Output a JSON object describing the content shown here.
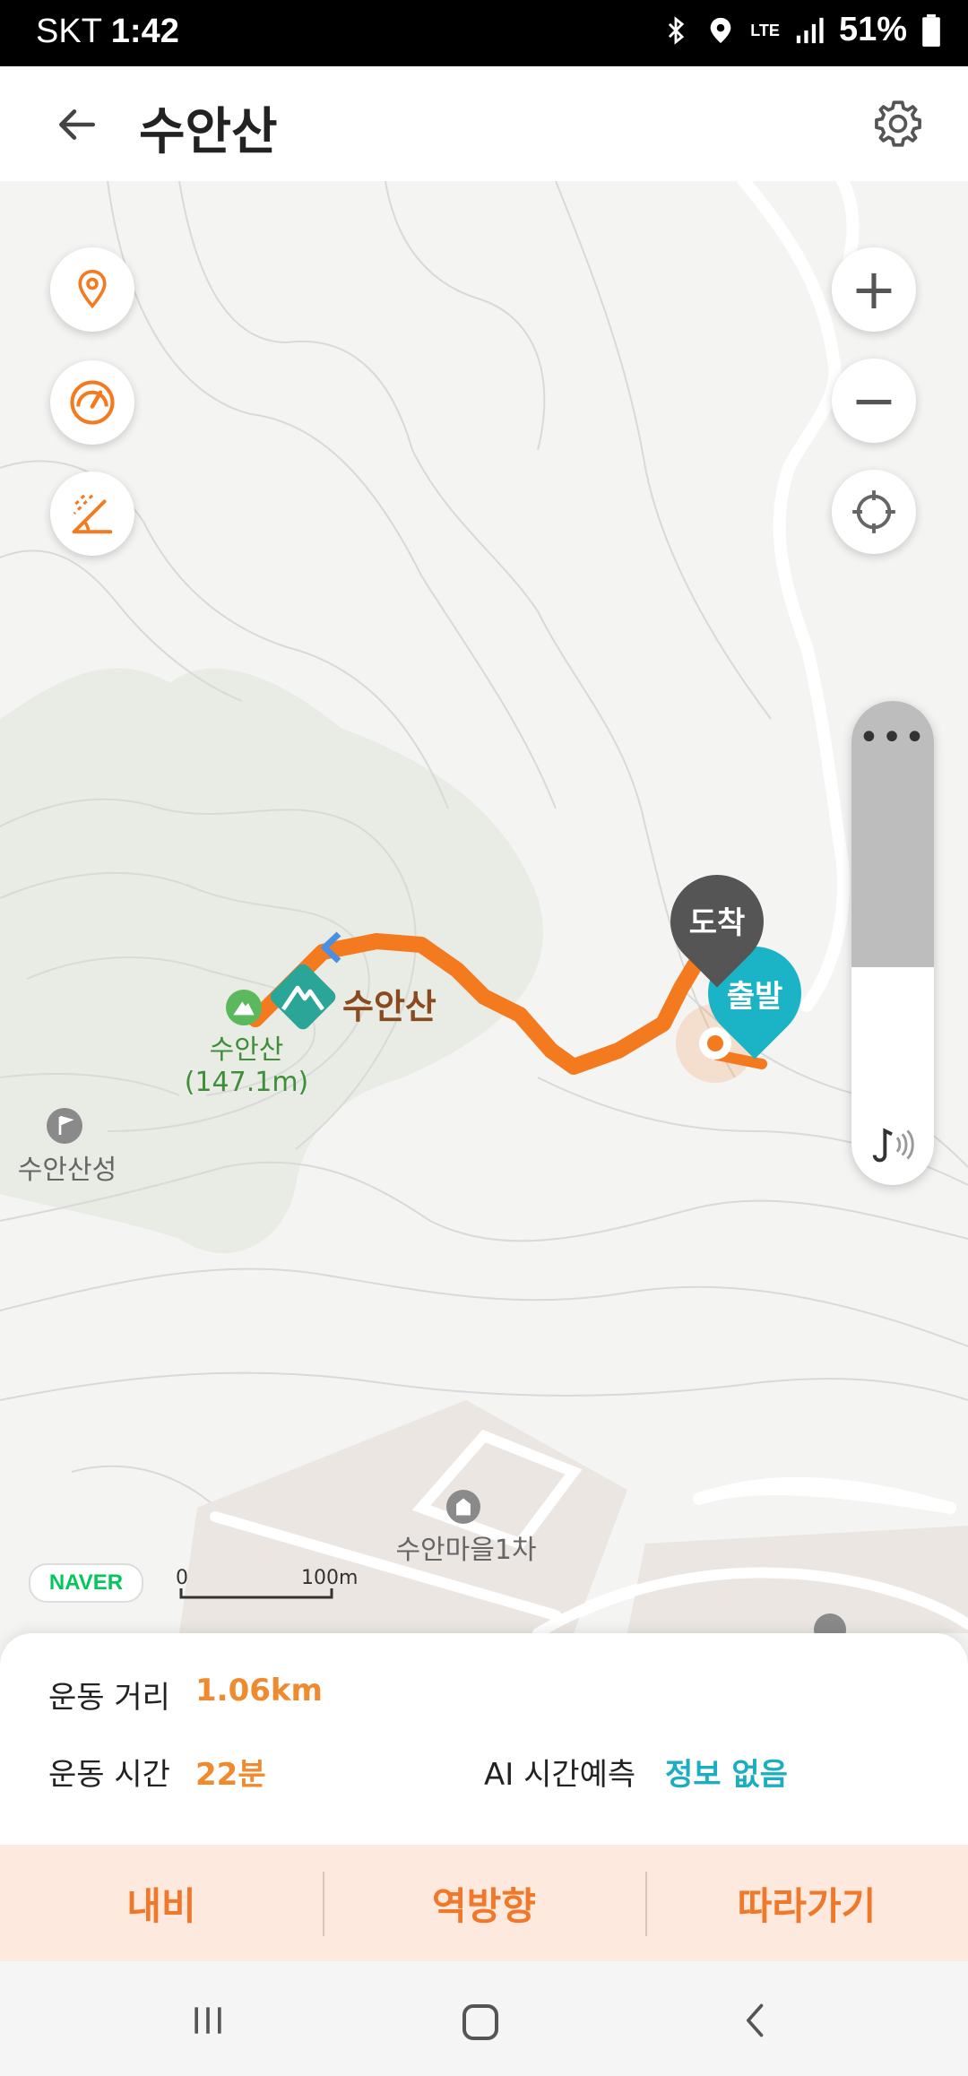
{
  "status_bar": {
    "carrier": "SKT",
    "time": "1:42",
    "network": "LTE",
    "battery": "51%"
  },
  "header": {
    "title": "수안산",
    "back_icon": "arrow-left-icon",
    "settings_icon": "gear-icon"
  },
  "map": {
    "peak_label": "수안산",
    "peak_sub": "(147.1m)",
    "peak_marker_label": "수안산",
    "fortress_label": "수안산성",
    "village_label": "수안마을1차",
    "arrive_label": "도착",
    "depart_label": "출발",
    "provider": "NAVER",
    "scale_start": "0",
    "scale_end": "100m",
    "route_color": "#f47a20",
    "volume_level": 0.55,
    "volume_dots": "•••"
  },
  "info": {
    "distance_label": "운동 거리",
    "distance_value": "1.06km",
    "time_label": "운동 시간",
    "time_value": "22분",
    "ai_label": "AI 시간예측",
    "ai_value": "정보 없음"
  },
  "actions": {
    "nav": "내비",
    "reverse": "역방향",
    "follow": "따라가기"
  }
}
